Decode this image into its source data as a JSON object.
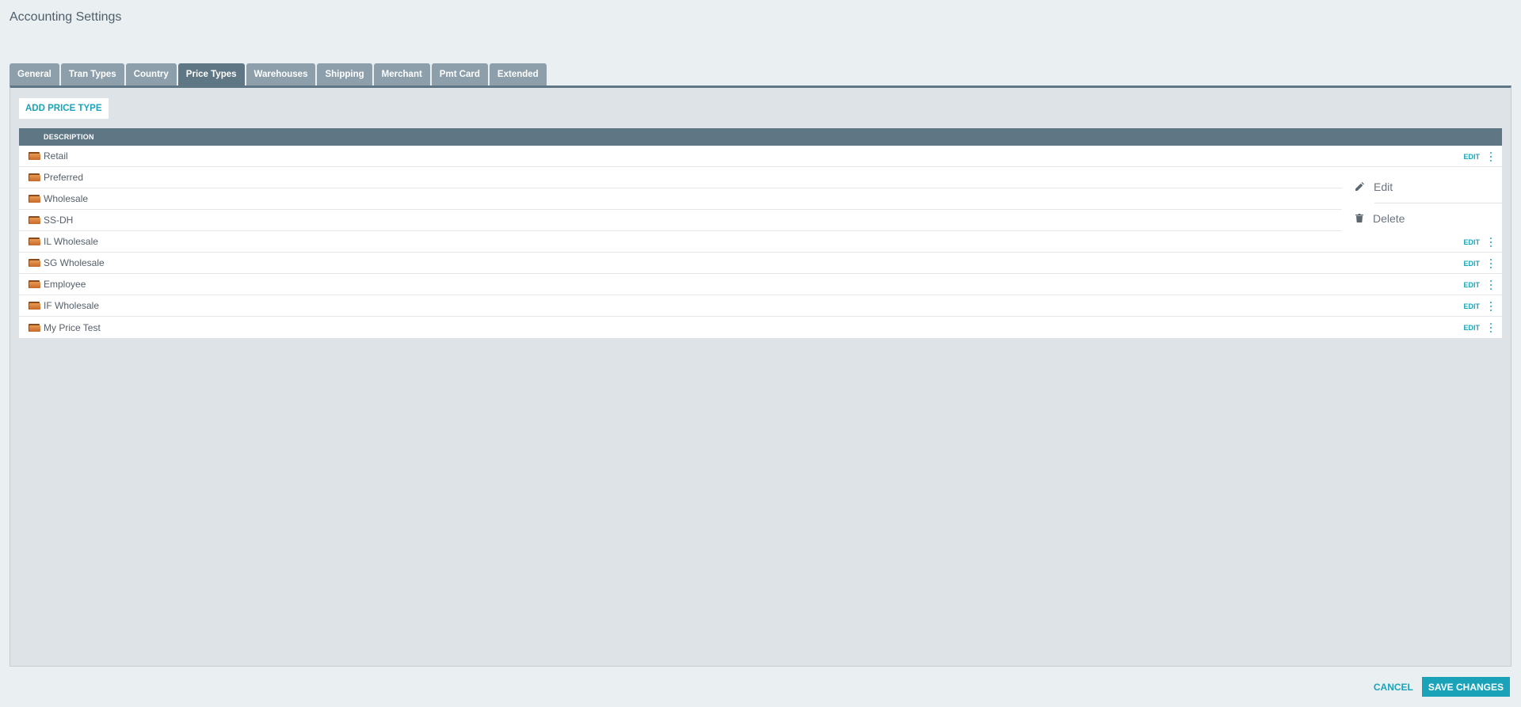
{
  "page": {
    "title": "Accounting Settings"
  },
  "tabs": [
    {
      "label": "General",
      "active": false
    },
    {
      "label": "Tran Types",
      "active": false
    },
    {
      "label": "Country",
      "active": false
    },
    {
      "label": "Price Types",
      "active": true
    },
    {
      "label": "Warehouses",
      "active": false
    },
    {
      "label": "Shipping",
      "active": false
    },
    {
      "label": "Merchant",
      "active": false
    },
    {
      "label": "Pmt Card",
      "active": false
    },
    {
      "label": "Extended",
      "active": false
    }
  ],
  "toolbar": {
    "add_label": "ADD PRICE TYPE"
  },
  "grid": {
    "header": {
      "description": "DESCRIPTION"
    },
    "edit_label": "EDIT",
    "rows": [
      {
        "description": "Retail",
        "show_actions": true
      },
      {
        "description": "Preferred",
        "show_actions": false
      },
      {
        "description": "Wholesale",
        "show_actions": false
      },
      {
        "description": "SS-DH",
        "show_actions": false
      },
      {
        "description": "IL Wholesale",
        "show_actions": true
      },
      {
        "description": "SG Wholesale",
        "show_actions": true
      },
      {
        "description": "Employee",
        "show_actions": true
      },
      {
        "description": "IF Wholesale",
        "show_actions": true
      },
      {
        "description": "My Price Test",
        "show_actions": true
      }
    ]
  },
  "context_menu": {
    "items": [
      {
        "label": "Edit",
        "icon": "pencil-icon"
      },
      {
        "label": "Delete",
        "icon": "trash-icon"
      }
    ]
  },
  "footer": {
    "cancel_label": "CANCEL",
    "save_label": "SAVE CHANGES"
  },
  "colors": {
    "accent": "#1aa3b8",
    "tab_bg": "#8c9fab",
    "tab_active_bg": "#5f7784",
    "header_bg": "#5f7784"
  }
}
